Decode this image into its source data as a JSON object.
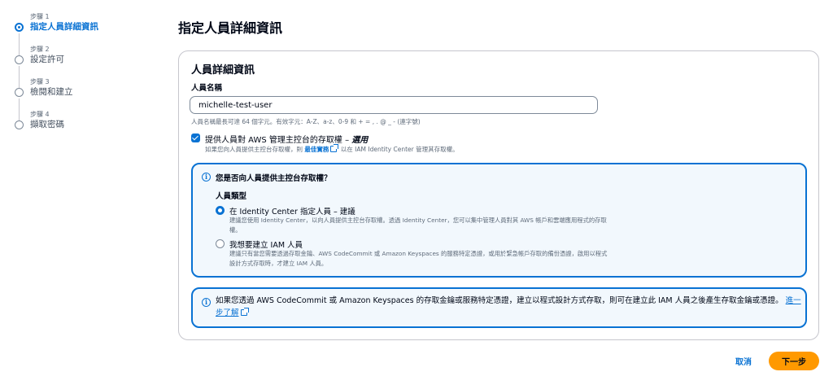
{
  "steps": [
    {
      "num": "步驟 1",
      "label": "指定人員詳細資訊"
    },
    {
      "num": "步驟 2",
      "label": "設定許可"
    },
    {
      "num": "步驟 3",
      "label": "檢閱和建立"
    },
    {
      "num": "步驟 4",
      "label": "擷取密碼"
    }
  ],
  "page_title": "指定人員詳細資訊",
  "section": {
    "title": "人員詳細資訊",
    "user_name_label": "人員名稱",
    "user_name_value": "michelle-test-user",
    "user_name_constraint": "人員名稱最長可達 64 個字元。有效字元：A-Z、a-z、0-9 和 + = , . @ _ - (連字號)",
    "console_access": {
      "label": "提供人員對 AWS 管理主控台的存取權 – ",
      "optional": "選用",
      "desc_before": "如果您向人員提供主控台存取權，則 ",
      "desc_link": "最佳實務",
      "desc_after": " 以在 IAM Identity Center 管理其存取權。"
    }
  },
  "alert_console": {
    "title": "您是否向人員提供主控台存取權？",
    "user_type_label": "人員類型",
    "options": [
      {
        "label": "在 Identity Center 指定人員 – 建議",
        "desc": "建議您使用 Identity Center，以向人員提供主控台存取權。透過 Identity Center，您可以集中管理人員對其 AWS 帳戶和雲端應用程式的存取權。",
        "selected": true
      },
      {
        "label": "我想要建立 IAM 人員",
        "desc": "建議只有當您需要透過存取金鑰、AWS CodeCommit 或 Amazon Keyspaces 的服務特定憑證，或用於緊急帳戶存取的備份憑證，啟用以程式設計方式存取時，才建立 IAM 人員。",
        "selected": false
      }
    ]
  },
  "alert_programmatic": {
    "text": "如果您透過 AWS CodeCommit 或 Amazon Keyspaces 的存取金鑰或服務特定憑證，建立以程式設計方式存取，則可在建立此 IAM 人員之後產生存取金鑰或憑證。",
    "link": "進一步了解"
  },
  "footer": {
    "cancel": "取消",
    "next": "下一步"
  },
  "colors": {
    "accent": "#0972d3",
    "primary_button": "#ff9900",
    "alert_bg": "#f2f8fd"
  }
}
